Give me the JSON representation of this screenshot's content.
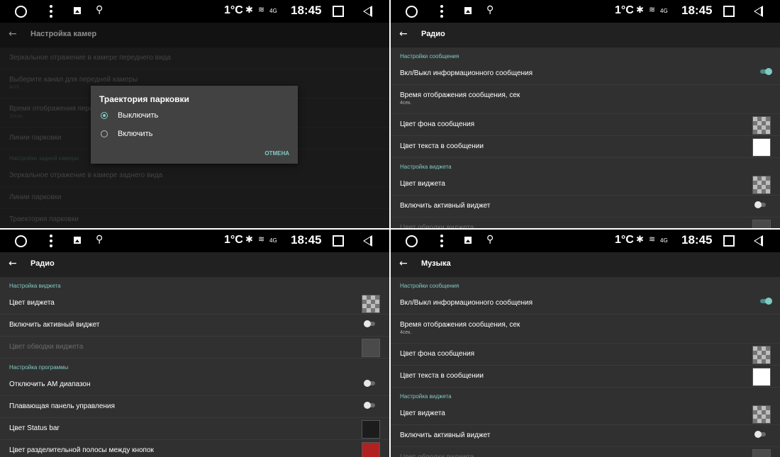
{
  "status": {
    "temp": "1°C",
    "time": "18:45",
    "network": "4G",
    "bluetooth_icon": "bluetooth-icon",
    "wifi_icon": "wifi-icon"
  },
  "panel0": {
    "title": "Настройка камер",
    "rows": [
      "Зеркальное отражение в камере переднего вида",
      "Выберите канал для передней камеры",
      "AUX",
      "Время отображения пере",
      "10сек.",
      "Линии парковки",
      "Настройки задней камеры",
      "Зеркальное отражение в камере заднего вида",
      "Линии парковки",
      "Траектория парковки"
    ],
    "dialog": {
      "title": "Траектория парковки",
      "opt_off": "Выключить",
      "opt_on": "Включить",
      "cancel": "ОТМЕНА",
      "selected": "Выключить"
    }
  },
  "panel1": {
    "title": "Радио",
    "section1": "Настройки сообщения",
    "r1": "Вкл/Выкл информационного сообщения",
    "r2": "Время отображения сообщения, сек",
    "r2s": "4сек.",
    "r3": "Цвет фона сообщения",
    "r4": "Цвет текста в сообщении",
    "section2": "Настройка виджета",
    "r5": "Цвет виджета",
    "r6": "Включить активный виджет",
    "r7": "Цвет обводки виджета"
  },
  "panel2": {
    "title": "Радио",
    "section1": "Настройка виджета",
    "r1": "Цвет виджета",
    "r2": "Включить активный виджет",
    "r3": "Цвет обводки виджета",
    "section2": "Настройка программы",
    "r4": "Отключить AM диапазон",
    "r5": "Плавающая панель управления",
    "r6": "Цвет Status bar",
    "r7": "Цвет разделительной полосы между кнопок",
    "colors": {
      "statusbar": "#1c1c1c",
      "divider": "#b02222",
      "border": "#4a4a4a"
    }
  },
  "panel3": {
    "title": "Музыка",
    "section1": "Настройки сообщения",
    "r1": "Вкл/Выкл информационного сообщения",
    "r2": "Время отображения сообщения, сек",
    "r2s": "4сек.",
    "r3": "Цвет фона сообщения",
    "r4": "Цвет текста в сообщении",
    "section2": "Настройка виджета",
    "r5": "Цвет виджета",
    "r6": "Включить активный виджет",
    "r7": "Цвет обводки виджета"
  },
  "colors": {
    "accent": "#80cbc4",
    "background": "#303030",
    "appbar": "#212121",
    "statusbar": "#000000"
  }
}
